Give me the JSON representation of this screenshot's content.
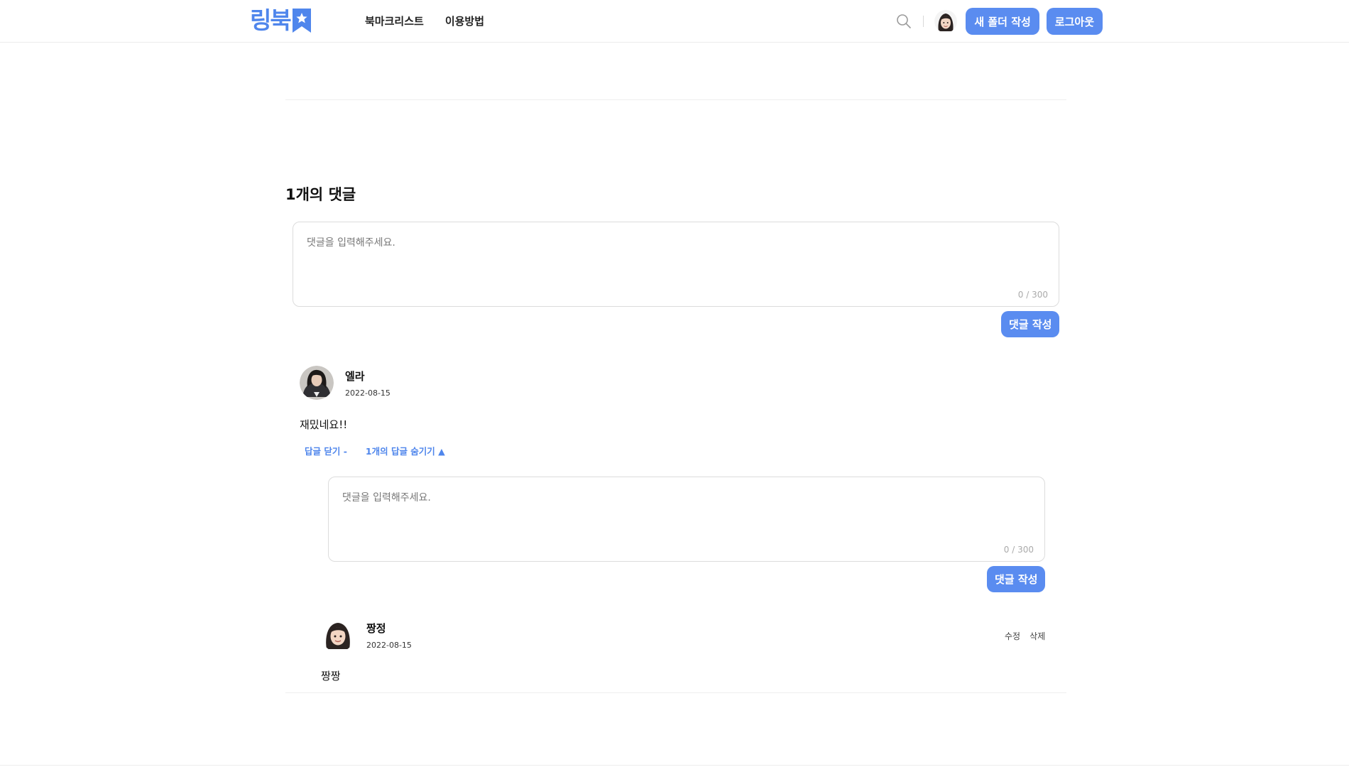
{
  "header": {
    "logo_text": "링북",
    "nav": [
      "북마크리스트",
      "이용방법"
    ],
    "new_folder_label": "새 폴더 작성",
    "logout_label": "로그아웃"
  },
  "comments_section": {
    "count_label": "1개의 댓글",
    "editor": {
      "placeholder": "댓글을 입력해주세요.",
      "counter": "0 / 300",
      "submit_label": "댓글 작성"
    }
  },
  "comment": {
    "author": "엘라",
    "date": "2022-08-15",
    "text": "재밌네요!!",
    "reply_close_label": "답글 닫기 -",
    "hide_replies_label": "1개의 답글 숨기기 ▲",
    "reply_editor": {
      "placeholder": "댓글을 입력해주세요.",
      "counter": "0 / 300",
      "submit_label": "댓글 작성"
    },
    "reply": {
      "author": "짱정",
      "date": "2022-08-15",
      "text": "짱짱",
      "edit_label": "수정",
      "delete_label": "삭제"
    }
  },
  "colors": {
    "accent": "#5a8cf0",
    "logo": "#4f86ec"
  }
}
